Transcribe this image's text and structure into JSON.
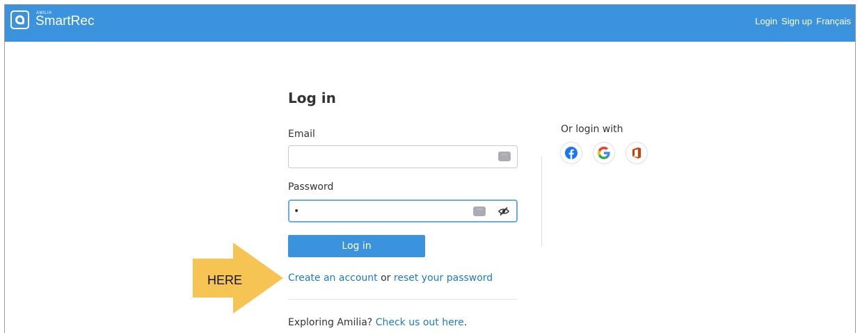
{
  "header": {
    "brand_small": "AMILIA",
    "brand": "SmartRec",
    "nav": {
      "login": "Login",
      "signup": "Sign up",
      "language": "Français"
    }
  },
  "form": {
    "title": "Log in",
    "email_label": "Email",
    "email_value": "",
    "password_label": "Password",
    "password_value": "•",
    "submit_label": "Log in"
  },
  "links": {
    "create_account": "Create an account",
    "or": "or",
    "reset_password": "reset your password",
    "explore_prefix": "Exploring Amilia?",
    "explore_link": "Check us out here",
    "explore_suffix": "."
  },
  "social": {
    "title": "Or login with",
    "providers": [
      "facebook-icon",
      "google-icon",
      "office-icon"
    ]
  },
  "annotation": {
    "text": "HERE",
    "color": "#f6c453"
  },
  "colors": {
    "accent": "#3a93dc",
    "link": "#1f7ac4"
  }
}
